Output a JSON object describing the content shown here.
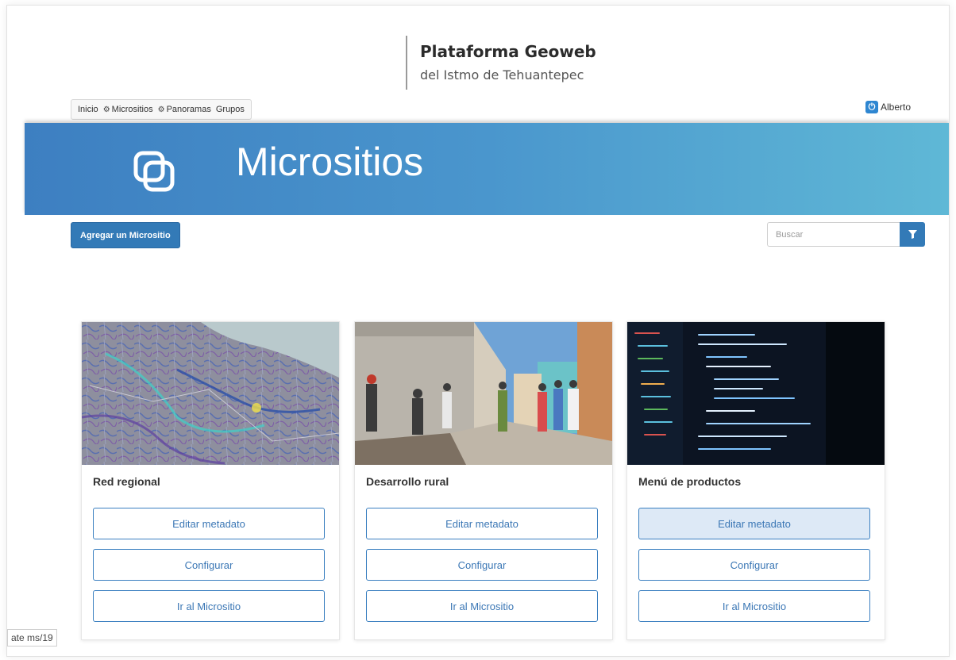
{
  "brand": {
    "title": "Plataforma Geoweb",
    "subtitle": "del Istmo de Tehuantepec"
  },
  "nav": {
    "items": [
      {
        "label": "Inicio",
        "icon": ""
      },
      {
        "label": "Micrositios",
        "icon": "gear-icon"
      },
      {
        "label": "Panoramas",
        "icon": "gear-icon"
      },
      {
        "label": "Grupos",
        "icon": ""
      }
    ]
  },
  "user": {
    "name": "Alberto",
    "icon": "power-icon"
  },
  "banner": {
    "title": "Micrositios",
    "icon": "stacked-squares-icon",
    "colors": [
      "#3d7fc1",
      "#5fb8d6"
    ]
  },
  "toolbar": {
    "add_label": "Agregar un Micrositio",
    "search_placeholder": "Buscar",
    "filter_icon": "filter-icon"
  },
  "cards": [
    {
      "title": "Red regional",
      "image": "regional-map-image",
      "buttons": [
        "Editar metadato",
        "Configurar",
        "Ir al Micrositio"
      ]
    },
    {
      "title": "Desarrollo rural",
      "image": "rural-street-photo",
      "buttons": [
        "Editar metadato",
        "Configurar",
        "Ir al Micrositio"
      ]
    },
    {
      "title": "Menú de productos",
      "image": "code-screen-photo",
      "buttons": [
        "Editar metadato",
        "Configurar",
        "Ir al Micrositio"
      ],
      "hovered_button": "Editar metadato"
    }
  ],
  "status_bar": {
    "text": "ate ms/19"
  },
  "colors": {
    "accent": "#337ab7",
    "button_text": "#3b77b5",
    "hover_fill": "#dde9f6"
  }
}
